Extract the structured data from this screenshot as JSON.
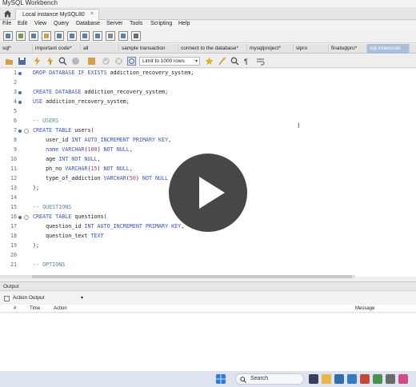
{
  "window": {
    "title": "MySQL Workbench"
  },
  "connection_tab": {
    "label": "Local instance MySQL80",
    "close": "×"
  },
  "menu": [
    "File",
    "Edit",
    "View",
    "Query",
    "Database",
    "Server",
    "Tools",
    "Scripting",
    "Help"
  ],
  "sql_tabs": [
    {
      "label": "sql*",
      "active": false
    },
    {
      "label": "important code*",
      "active": false
    },
    {
      "label": "all",
      "active": false
    },
    {
      "label": "sample transaction",
      "active": false
    },
    {
      "label": "connect to the database*",
      "active": false
    },
    {
      "label": "mysqlproject*",
      "active": false
    },
    {
      "label": "slpro",
      "active": false
    },
    {
      "label": "finalsqlpro*",
      "active": false
    },
    {
      "label": "sql-innercode",
      "active": true
    }
  ],
  "query_toolbar": {
    "limit_label": "Limit to 1000 rows"
  },
  "editor": {
    "lines": [
      {
        "n": "1",
        "dot": true,
        "fold": false,
        "code": "DROP DATABASE IF EXISTS addiction_recovery_system;"
      },
      {
        "n": "2",
        "dot": false,
        "fold": false,
        "code": ""
      },
      {
        "n": "3",
        "dot": true,
        "fold": false,
        "code": "CREATE DATABASE addiction_recovery_system;"
      },
      {
        "n": "4",
        "dot": true,
        "fold": false,
        "code": "USE addiction_recovery_system;"
      },
      {
        "n": "5",
        "dot": false,
        "fold": false,
        "code": ""
      },
      {
        "n": "6",
        "dot": false,
        "fold": false,
        "code": "-- USERS"
      },
      {
        "n": "7",
        "dot": true,
        "fold": true,
        "code": "CREATE TABLE users("
      },
      {
        "n": "8",
        "dot": false,
        "fold": false,
        "code": "    user_id INT AUTO_INCREMENT PRIMARY KEY,"
      },
      {
        "n": "9",
        "dot": false,
        "fold": false,
        "code": "    name VARCHAR(100) NOT NULL,"
      },
      {
        "n": "10",
        "dot": false,
        "fold": false,
        "code": "    age INT NOT NULL,"
      },
      {
        "n": "11",
        "dot": false,
        "fold": false,
        "code": "    ph_no VARCHAR(15) NOT NULL,"
      },
      {
        "n": "12",
        "dot": false,
        "fold": false,
        "code": "    type_of_addiction VARCHAR(50) NOT NULL"
      },
      {
        "n": "13",
        "dot": false,
        "fold": false,
        "code": ");"
      },
      {
        "n": "14",
        "dot": false,
        "fold": false,
        "code": ""
      },
      {
        "n": "15",
        "dot": false,
        "fold": false,
        "code": "-- QUESTIONS"
      },
      {
        "n": "16",
        "dot": true,
        "fold": true,
        "code": "CREATE TABLE questions("
      },
      {
        "n": "17",
        "dot": false,
        "fold": false,
        "code": "    question_id INT AUTO_INCREMENT PRIMARY KEY,"
      },
      {
        "n": "18",
        "dot": false,
        "fold": false,
        "code": "    question_text TEXT"
      },
      {
        "n": "19",
        "dot": false,
        "fold": false,
        "code": ");"
      },
      {
        "n": "20",
        "dot": false,
        "fold": false,
        "code": ""
      },
      {
        "n": "21",
        "dot": false,
        "fold": false,
        "code": "-- OPTIONS"
      }
    ]
  },
  "output": {
    "header": "Output",
    "selector": "Action Output",
    "columns": [
      "#",
      "Time",
      "Action",
      "Message"
    ]
  },
  "taskbar": {
    "search": "Search"
  },
  "colors": {
    "keyword": "#3b56c4",
    "number": "#c02f7a",
    "comment": "#5a8aa0",
    "active_tab": "#a9bfd9"
  }
}
